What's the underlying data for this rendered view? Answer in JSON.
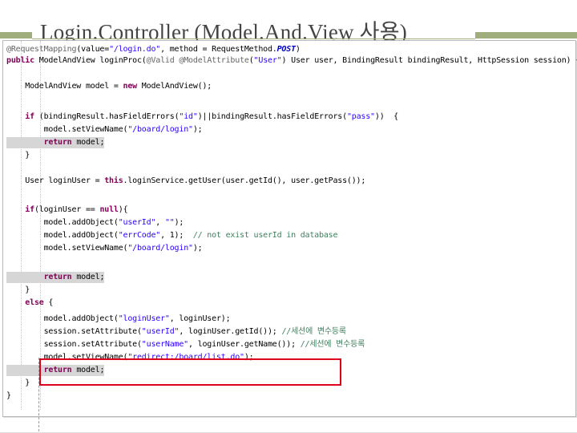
{
  "slide": {
    "title": "Login.Controller (Model.And.View 사용)"
  },
  "code": {
    "lines": [
      {
        "t": "@RequestMapping(value=\"/login.do\", method = RequestMethod.POST)"
      },
      {
        "t": "public ModelAndView loginProc(@Valid @ModelAttribute(\"User\") User user, BindingResult bindingResult, HttpSession session) {"
      },
      {
        "t": ""
      },
      {
        "t": "    ModelAndView model = new ModelAndView();"
      },
      {
        "t": ""
      },
      {
        "t": "    if (bindingResult.hasFieldErrors(\"id\")||bindingResult.hasFieldErrors(\"pass\"))  {"
      },
      {
        "t": "        model.setViewName(\"/board/login\");"
      },
      {
        "t": "        return model;"
      },
      {
        "t": "    }"
      },
      {
        "t": ""
      },
      {
        "t": "    User loginUser = this.loginService.getUser(user.getId(), user.getPass());"
      },
      {
        "t": ""
      },
      {
        "t": "    if(loginUser == null){"
      },
      {
        "t": "        model.addObject(\"userId\", \"\");"
      },
      {
        "t": "        model.addObject(\"errCode\", 1);  // not exist userId in database"
      },
      {
        "t": "        model.setViewName(\"/board/login\");"
      },
      {
        "t": ""
      },
      {
        "t": "        return model;"
      },
      {
        "t": "    }"
      },
      {
        "t": "    else {"
      },
      {
        "t": "        model.addObject(\"loginUser\", loginUser);"
      },
      {
        "t": "        session.setAttribute(\"userId\", loginUser.getId()); //세션에 변수등록"
      },
      {
        "t": "        session.setAttribute(\"userName\", loginUser.getName()); //세션에 변수등록"
      },
      {
        "t": "        model.setViewName(\"redirect:/board/list.do\");"
      },
      {
        "t": "        return model;"
      },
      {
        "t": "    }"
      },
      {
        "t": "}"
      }
    ]
  },
  "colors": {
    "accent_bar": "#a0ae7d",
    "highlight_box": "#e0001a",
    "keyword": "#7f0055",
    "string": "#2a00ff",
    "comment": "#3f7f5f"
  }
}
